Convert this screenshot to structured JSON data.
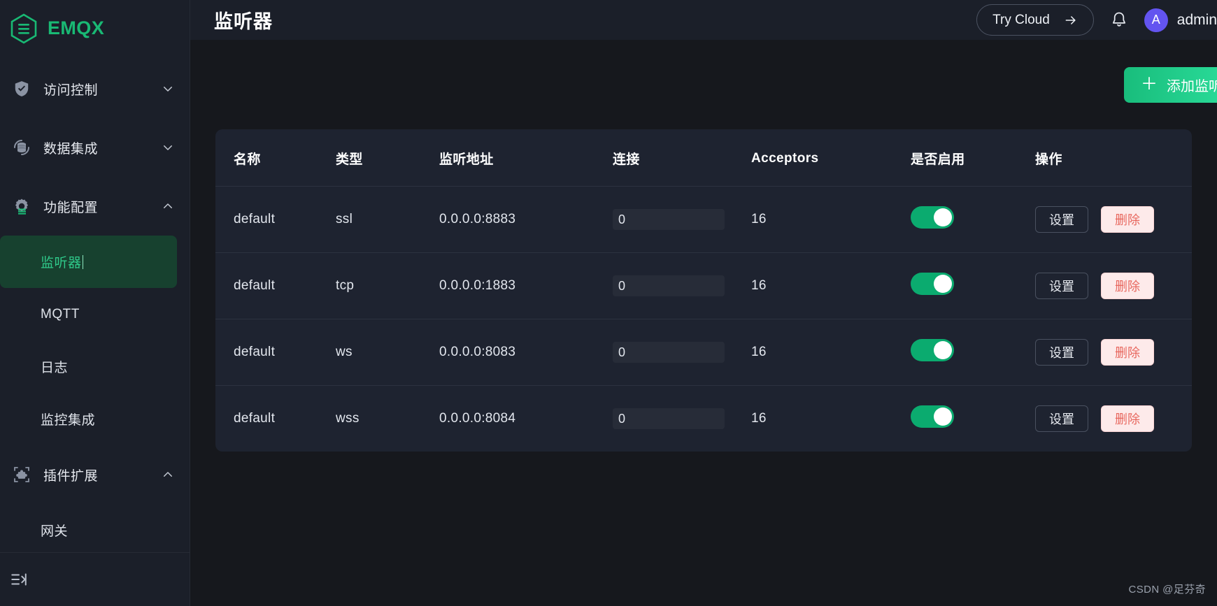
{
  "brand": {
    "name": "EMQX",
    "logo_icon": "emqx-hexagon-logo"
  },
  "sidebar": {
    "groups": [
      {
        "label": "访问控制",
        "icon": "shield-check-icon",
        "caret": "chevron-down-icon",
        "expanded": false,
        "children": []
      },
      {
        "label": "数据集成",
        "icon": "database-sync-icon",
        "caret": "chevron-down-icon",
        "expanded": false,
        "children": []
      },
      {
        "label": "功能配置",
        "icon": "gear-config-icon",
        "caret": "chevron-up-icon",
        "expanded": true,
        "children": [
          {
            "label": "监听器",
            "active": true
          },
          {
            "label": "MQTT",
            "active": false
          },
          {
            "label": "日志",
            "active": false
          },
          {
            "label": "监控集成",
            "active": false
          }
        ]
      },
      {
        "label": "插件扩展",
        "icon": "puzzle-plugin-icon",
        "caret": "chevron-up-icon",
        "expanded": true,
        "children": [
          {
            "label": "网关",
            "active": false
          }
        ]
      }
    ],
    "collapse_icon": "sidebar-collapse-icon"
  },
  "header": {
    "title": "监听器",
    "try_cloud_label": "Try Cloud",
    "try_cloud_icon": "arrow-right-icon",
    "bell_icon": "bell-notification-icon",
    "avatar_initial": "A",
    "username": "admin"
  },
  "toolbar": {
    "add_listener_label": "添加监听器",
    "add_icon": "plus-icon"
  },
  "table": {
    "columns": [
      "名称",
      "类型",
      "监听地址",
      "连接",
      "Acceptors",
      "是否启用",
      "操作"
    ],
    "rows": [
      {
        "name": "default",
        "type": "ssl",
        "address": "0.0.0.0:8883",
        "connections": "0",
        "acceptors": "16",
        "enabled": true
      },
      {
        "name": "default",
        "type": "tcp",
        "address": "0.0.0.0:1883",
        "connections": "0",
        "acceptors": "16",
        "enabled": true
      },
      {
        "name": "default",
        "type": "ws",
        "address": "0.0.0.0:8083",
        "connections": "0",
        "acceptors": "16",
        "enabled": true
      },
      {
        "name": "default",
        "type": "wss",
        "address": "0.0.0.0:8084",
        "connections": "0",
        "acceptors": "16",
        "enabled": true
      }
    ],
    "op_settings_label": "设置",
    "op_delete_label": "删除"
  },
  "watermark": "CSDN @足芬奇",
  "colors": {
    "brand_green": "#19b974",
    "accent_green": "#0bab6f",
    "avatar_purple": "#6354f0",
    "danger_red": "#e8685f",
    "sidebar_bg": "#1b1f29",
    "content_bg": "#16181d",
    "card_bg": "#1e2330"
  }
}
